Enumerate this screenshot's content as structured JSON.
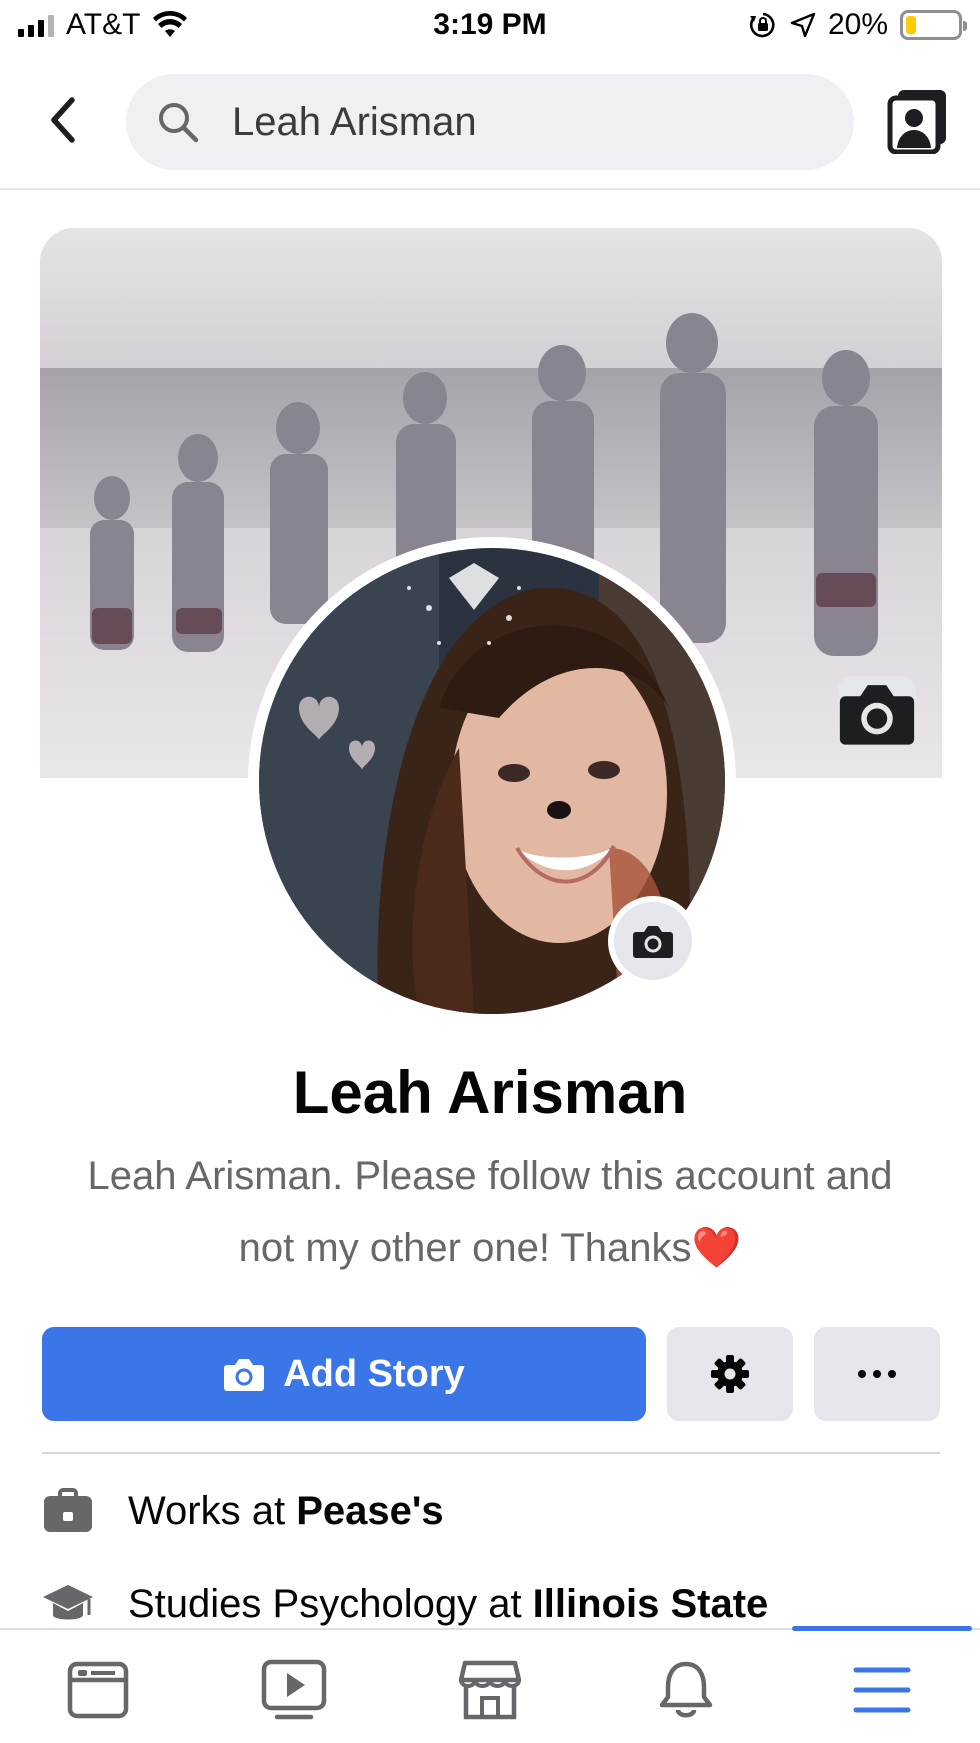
{
  "status_bar": {
    "carrier": "AT&T",
    "time": "3:19 PM",
    "battery_percent": "20%",
    "battery_level": 0.2,
    "battery_color": "#ffcc00",
    "icons": [
      "signal-icon",
      "wifi-icon",
      "orientation-lock-icon",
      "location-arrow-icon",
      "battery-icon"
    ]
  },
  "header": {
    "search_value": "Leah Arisman",
    "icons": [
      "back-chevron-icon",
      "search-icon",
      "switch-profile-icon"
    ]
  },
  "profile": {
    "name": "Leah Arisman",
    "bio": "Leah Arisman. Please follow this account and not my other one! Thanks❤️",
    "cover_camera_icon": "camera-icon",
    "avatar_camera_icon": "camera-icon"
  },
  "actions": {
    "add_story_label": "Add Story",
    "accent_color": "#3b76e8"
  },
  "intro": {
    "work_prefix": "Works at ",
    "work_place": "Pease's",
    "study_prefix": "Studies Psychology at ",
    "study_place": "Illinois State"
  },
  "tab_bar": {
    "tabs": [
      {
        "name": "news-feed",
        "icon": "news-feed-icon"
      },
      {
        "name": "watch",
        "icon": "video-play-icon"
      },
      {
        "name": "marketplace",
        "icon": "storefront-icon"
      },
      {
        "name": "notifications",
        "icon": "bell-icon"
      },
      {
        "name": "menu",
        "icon": "hamburger-menu-icon",
        "active": true
      }
    ]
  }
}
